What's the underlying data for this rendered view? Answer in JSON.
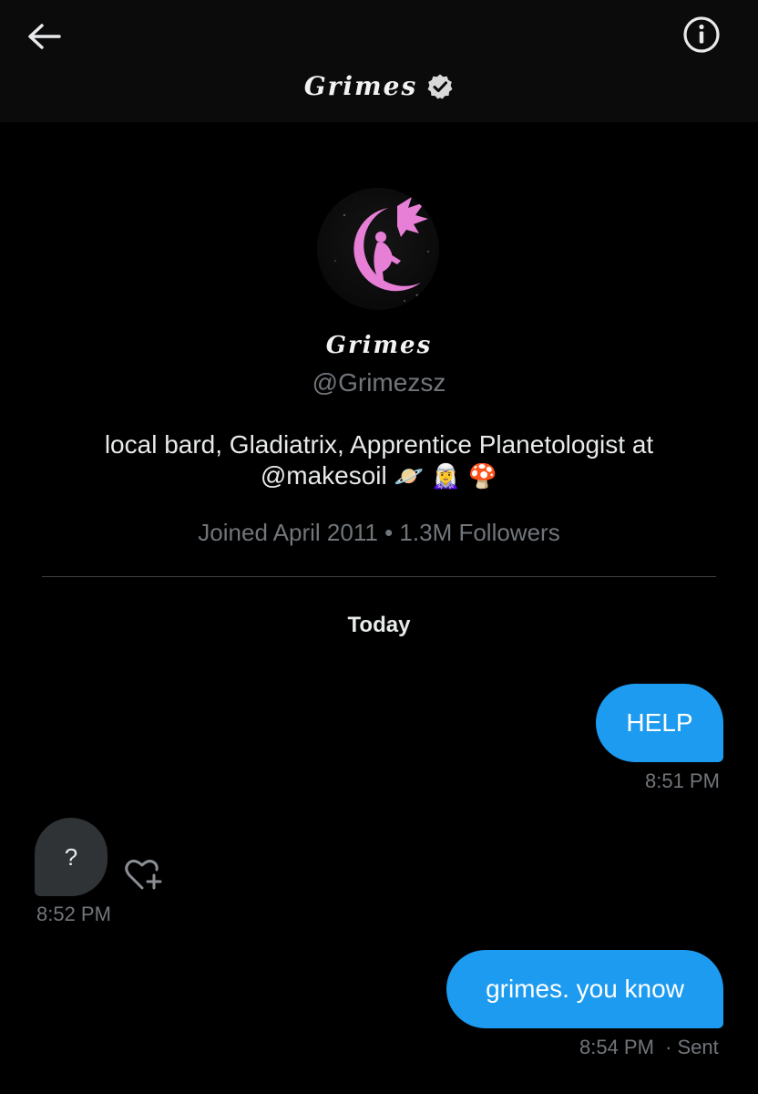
{
  "header": {
    "title": "Grimes",
    "verified": true,
    "back_icon": "arrow-left-icon",
    "info_icon": "info-icon"
  },
  "profile": {
    "name": "Grimes",
    "handle": "@Grimezsz",
    "bio_text": "local bard, Gladiatrix, Apprentice Planetologist at",
    "bio_mention": "@makesoil",
    "bio_emoji": "🪐 🧝‍♀️ 🍄",
    "joined": "Joined April 2011",
    "separator": "•",
    "followers": "1.3M Followers"
  },
  "conversation": {
    "day_label": "Today",
    "messages": [
      {
        "direction": "out",
        "text": "HELP",
        "time": "8:51 PM"
      },
      {
        "direction": "in",
        "text": "?",
        "time": "8:52 PM"
      },
      {
        "direction": "out",
        "text": "grimes. you know",
        "time": "8:54 PM",
        "status": "· Sent"
      }
    ]
  },
  "colors": {
    "background": "#000000",
    "header_bg": "#0b0b0b",
    "outgoing_bubble": "#1d9bf0",
    "incoming_bubble": "#2f3336",
    "muted_text": "#71767b",
    "avatar_pink": "#e77fd6"
  }
}
